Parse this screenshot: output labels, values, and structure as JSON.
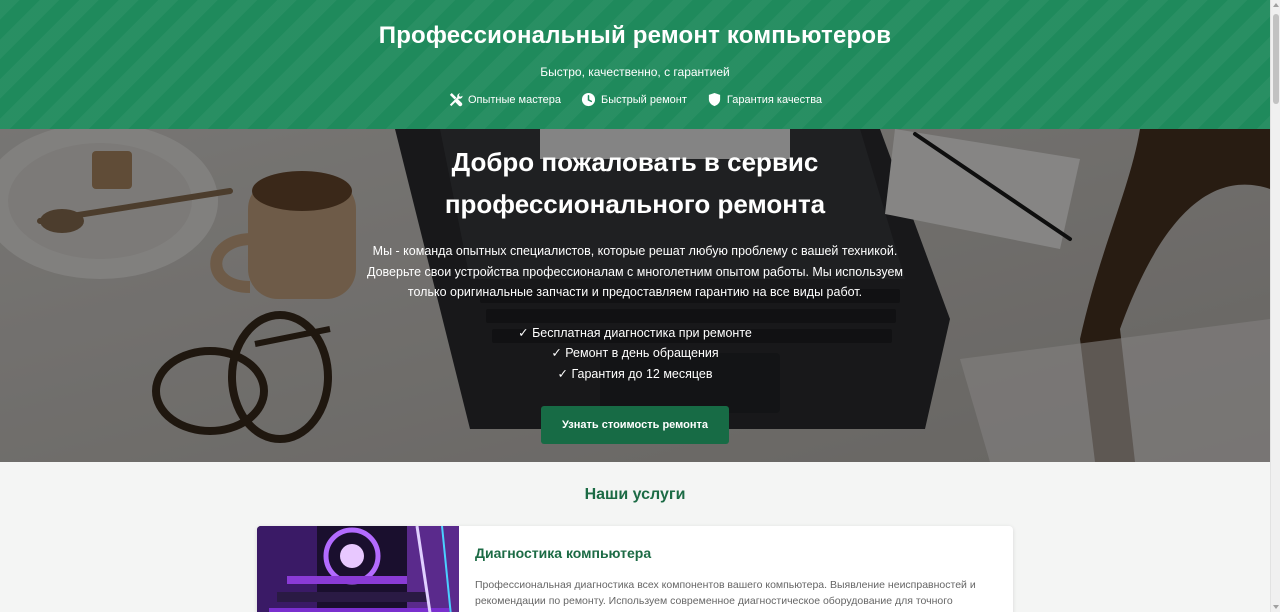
{
  "header": {
    "title": "Профессиональный ремонт компьютеров",
    "tagline": "Быстро, качественно, с гарантией",
    "features": [
      {
        "icon": "tools-icon",
        "label": "Опытные мастера"
      },
      {
        "icon": "clock-icon",
        "label": "Быстрый ремонт"
      },
      {
        "icon": "shield-icon",
        "label": "Гарантия качества"
      }
    ]
  },
  "hero": {
    "title": "Добро пожаловать в сервис профессионального ремонта",
    "lead": "Мы - команда опытных специалистов, которые решат любую проблему с вашей техникой. Доверьте свои устройства профессионалам с многолетним опытом работы. Мы используем только оригинальные запчасти и предоставляем гарантию на все виды работ.",
    "checks": [
      "✓ Бесплатная диагностика при ремонте",
      "✓ Ремонт в день обращения",
      "✓ Гарантия до 12 месяцев"
    ],
    "cta_label": "Узнать стоимость ремонта"
  },
  "services": {
    "title": "Наши услуги",
    "items": [
      {
        "title": "Диагностика компьютера",
        "description": "Профессиональная диагностика всех компонентов вашего компьютера. Выявление неисправностей и рекомендации по ремонту. Используем современное диагностическое оборудование для точного"
      }
    ]
  },
  "colors": {
    "header_bg": "#1f8a5c",
    "accent_dark": "#176b45",
    "heading_green": "#1c6b45"
  }
}
